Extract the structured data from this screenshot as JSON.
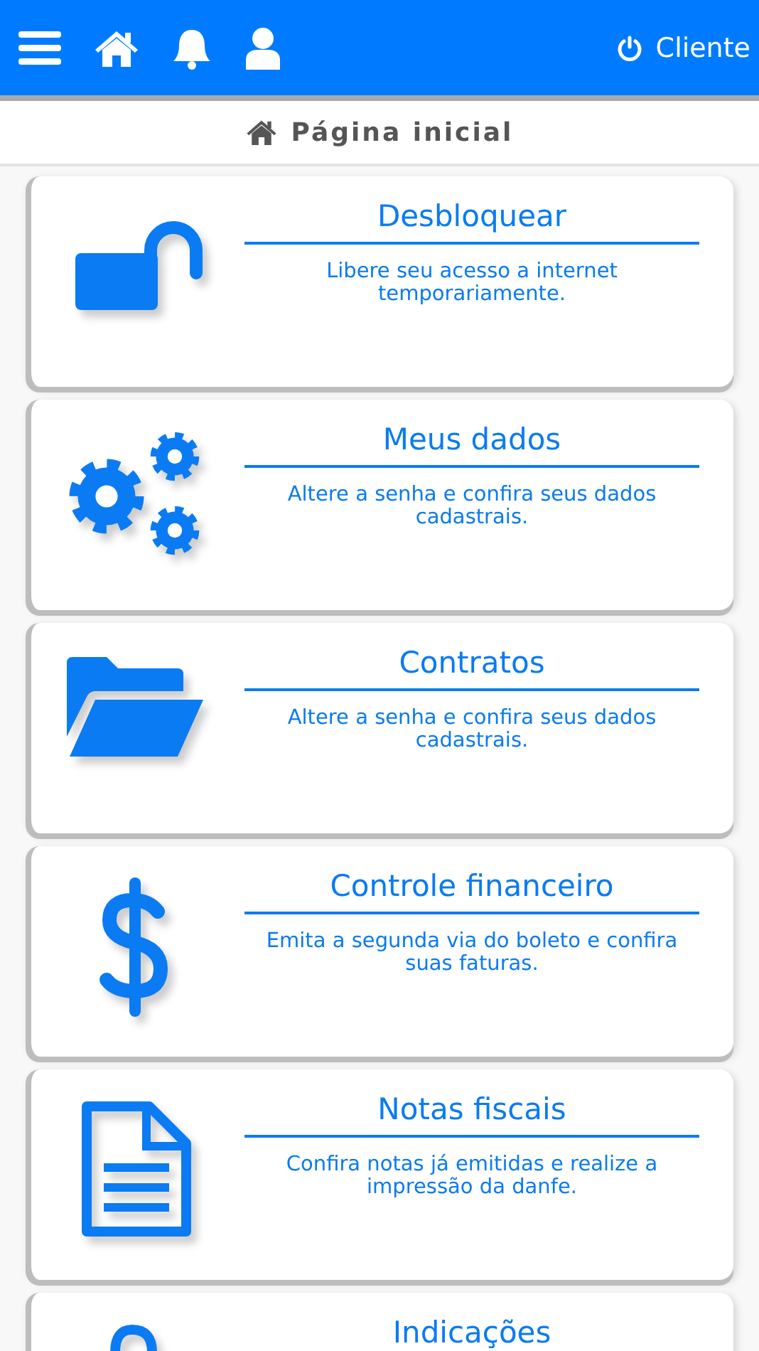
{
  "header": {
    "user_label": "Cliente"
  },
  "breadcrumb": {
    "title": "Página inicial"
  },
  "cards": [
    {
      "kind": "unlock",
      "title": "Desbloquear",
      "description": "Libere seu acesso a internet temporariamente."
    },
    {
      "kind": "gears",
      "title": "Meus dados",
      "description": "Altere a senha e confira seus dados cadastrais."
    },
    {
      "kind": "folder",
      "title": "Contratos",
      "description": "Altere a senha e confira seus dados cadastrais."
    },
    {
      "kind": "dollar",
      "title": "Controle financeiro",
      "description": "Emita a segunda via do boleto e confira suas faturas."
    },
    {
      "kind": "document",
      "title": "Notas fiscais",
      "description": "Confira notas já emitidas e realize a impressão da danfe."
    },
    {
      "kind": "partial",
      "title": "Indicações"
    }
  ]
}
